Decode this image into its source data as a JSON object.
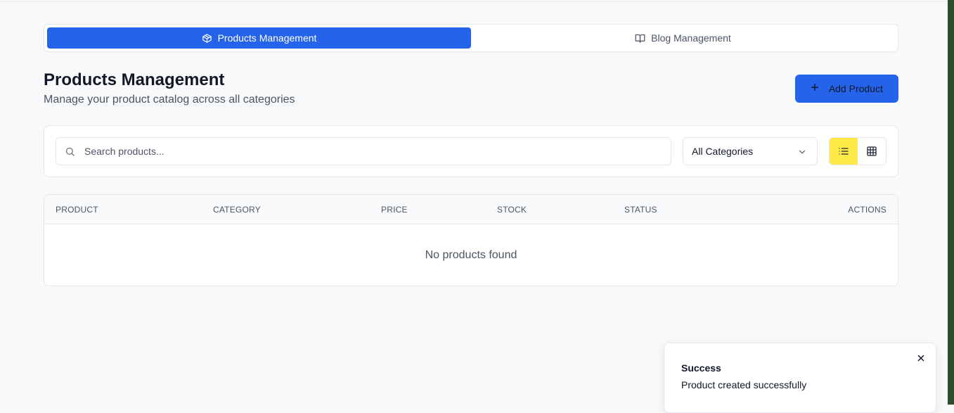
{
  "tabs": [
    {
      "label": "Products Management",
      "icon": "box-icon",
      "active": true
    },
    {
      "label": "Blog Management",
      "icon": "book-open-icon",
      "active": false
    }
  ],
  "header": {
    "title": "Products Management",
    "subtitle": "Manage your product catalog across all categories",
    "add_button_label": "Add Product"
  },
  "filters": {
    "search_placeholder": "Search products...",
    "search_value": "",
    "category_selected": "All Categories",
    "view_mode": "list"
  },
  "table": {
    "columns": [
      "PRODUCT",
      "CATEGORY",
      "PRICE",
      "STOCK",
      "STATUS",
      "ACTIONS"
    ],
    "empty_message": "No products found"
  },
  "toast": {
    "title": "Success",
    "message": "Product created successfully"
  },
  "colors": {
    "primary": "#2563eb",
    "toggle_active": "#fde947",
    "background": "#f8f9fb"
  }
}
